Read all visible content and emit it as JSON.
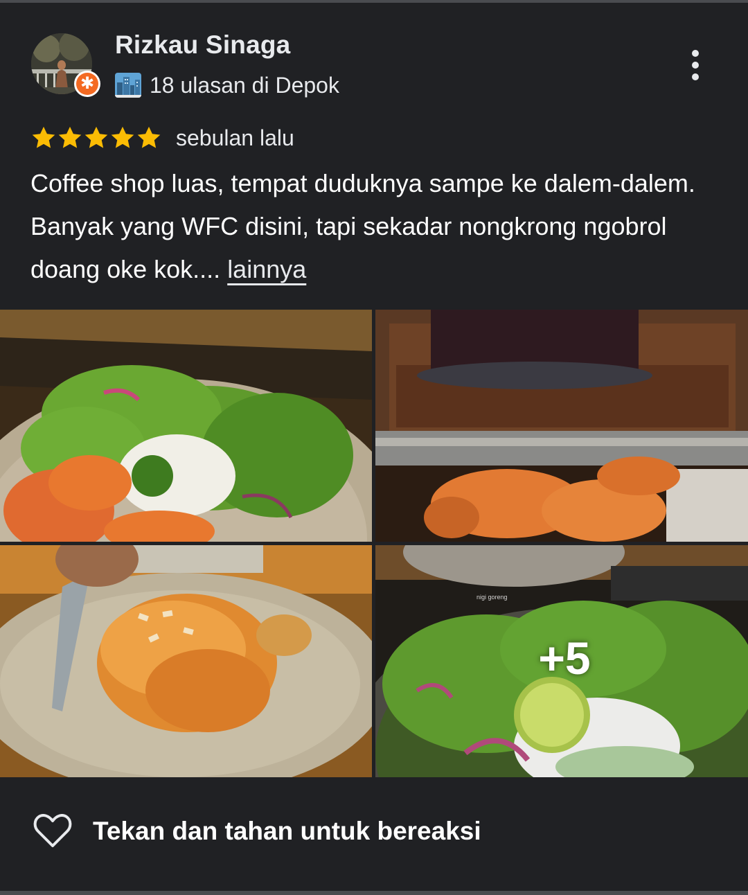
{
  "reviewer": {
    "name": "Rizkau Sinaga",
    "meta": "18 ulasan di Depok",
    "avatar_icon": "reviewer-avatar",
    "badge_icon": "local-guide-badge-icon",
    "badge_glyph": "✱",
    "meta_icon": "cityscape-icon"
  },
  "rating": {
    "stars": 5,
    "star_color": "#fbbc04",
    "date": "sebulan lalu"
  },
  "review": {
    "text": "Coffee shop luas, tempat duduknya sampe ke dalem-dalem. Banyak yang WFC disini, tapi sekadar nongkrong ngobrol doang oke kok.... ",
    "more_label": "lainnya"
  },
  "photos": {
    "items": [
      {
        "icon": "photo-rice-salad"
      },
      {
        "icon": "photo-cake-croissant-display"
      },
      {
        "icon": "photo-almond-croissant"
      },
      {
        "icon": "photo-rice-salad-lime"
      }
    ],
    "caption": "nigi goreng",
    "more_count": "+5"
  },
  "reaction": {
    "label": "Tekan dan tahan untuk bereaksi",
    "icon": "heart-outline-icon"
  },
  "colors": {
    "background": "#202124",
    "text": "#e8eaed",
    "badge": "#f46a22",
    "star": "#fbbc04"
  }
}
